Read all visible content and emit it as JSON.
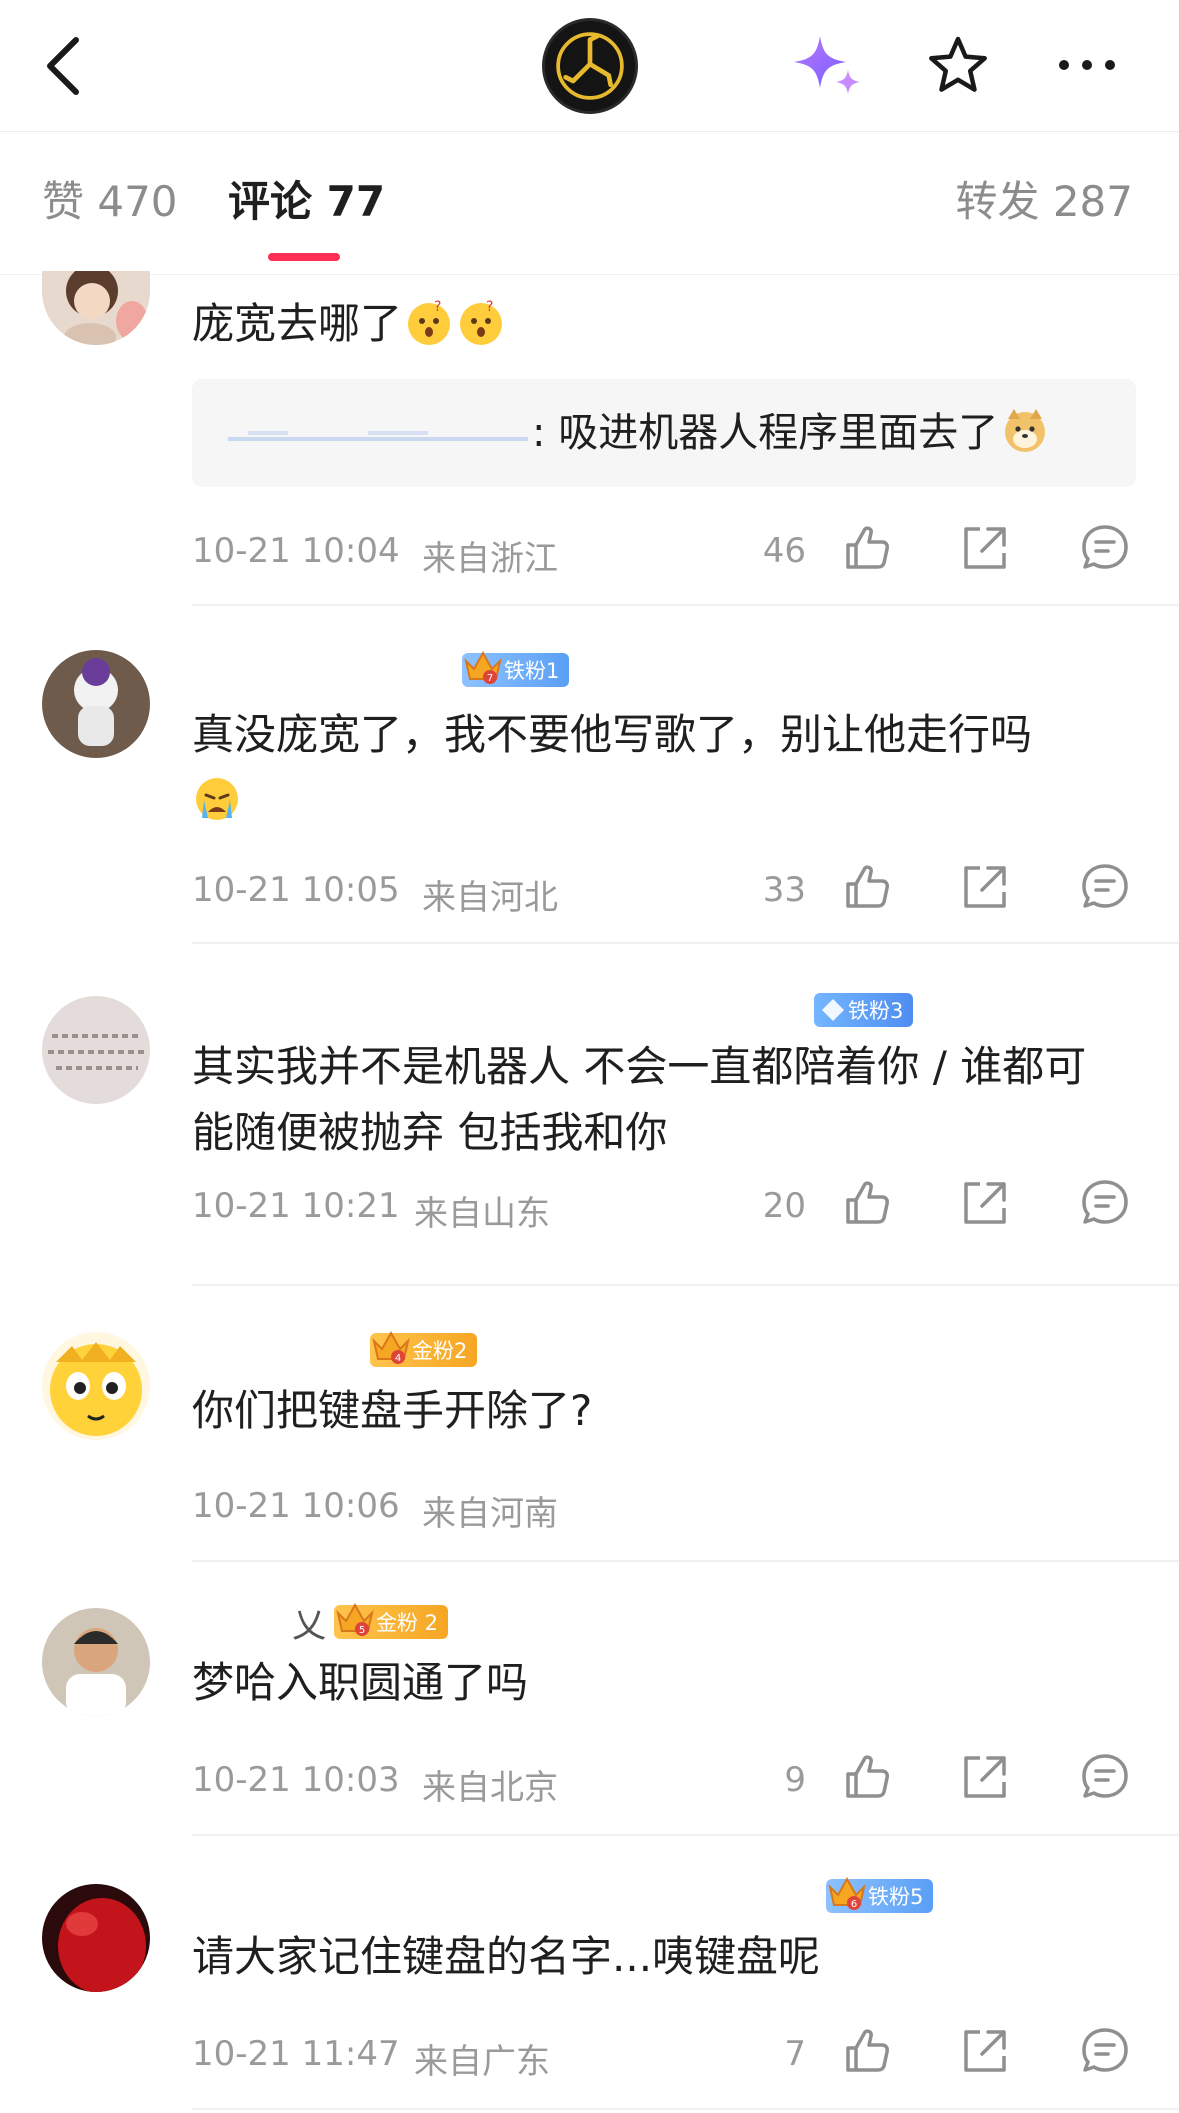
{
  "header": {
    "back_icon": "chevron-left-icon",
    "logo_icon": "band-logo",
    "ai_icon": "sparkle-icon",
    "favorite_icon": "star-outline-icon",
    "more_icon": "more-horizontal-icon"
  },
  "tabs": {
    "likes": "赞 470",
    "comments": "评论 77",
    "reposts": "转发 287",
    "active": "comments",
    "accent": "#ff2e55"
  },
  "comments": [
    {
      "text": "庞宽去哪了",
      "emojis": [
        "😲",
        "😲"
      ],
      "reply": {
        "text": ": 吸进机器人程序里面去了",
        "emoji": "🐕"
      },
      "time": "10-21 10:04",
      "location": "来自浙江",
      "likes": "46"
    },
    {
      "badge": {
        "label": "铁粉1",
        "color": "blue",
        "level": "7"
      },
      "text": "真没庞宽了，我不要他写歌了，别让他走行吗",
      "emojis": [
        "😭"
      ],
      "time": "10-21 10:05",
      "location": "来自河北",
      "likes": "33"
    },
    {
      "badge": {
        "label": "铁粉3",
        "color": "diamond"
      },
      "text": "其实我并不是机器人 不会一直都陪着你 / 谁都可能随便被抛弃 包括我和你",
      "time": "10-21 10:21",
      "location": "来自山东",
      "likes": "20"
    },
    {
      "badge": {
        "label": "金粉2",
        "color": "gold",
        "level": "4"
      },
      "text": "你们把键盘手开除了?",
      "time": "10-21 10:06",
      "location": "来自河南",
      "likes": ""
    },
    {
      "name_fragment": "乂",
      "badge": {
        "label": "金粉 2",
        "color": "gold",
        "level": "5"
      },
      "text": "梦哈入职圆通了吗",
      "time": "10-21 10:03",
      "location": "来自北京",
      "likes": "9"
    },
    {
      "badge": {
        "label": "铁粉5",
        "color": "blue",
        "level": "6"
      },
      "text": "请大家记住键盘的名字...咦键盘呢",
      "time": "10-21 11:47",
      "location": "来自广东",
      "likes": "7"
    }
  ]
}
